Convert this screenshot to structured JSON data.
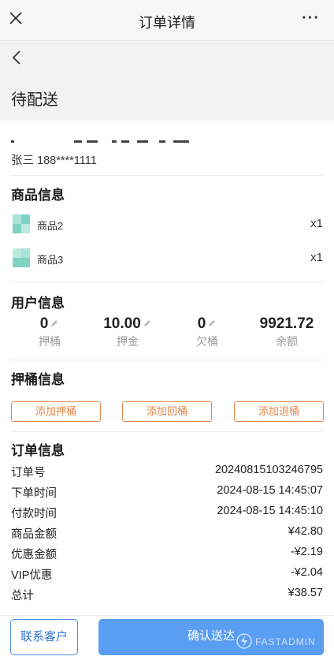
{
  "header": {
    "title": "订单详情",
    "more_label": "···"
  },
  "order_status": "待配送",
  "address": {
    "contact": "张三 188****1111"
  },
  "goods": {
    "title": "商品信息",
    "items": [
      {
        "name": "商品2",
        "qty": "x1"
      },
      {
        "name": "商品3",
        "qty": "x1"
      }
    ]
  },
  "user_info": {
    "title": "用户信息",
    "stats": [
      {
        "value": "0",
        "label": "押桶",
        "editable": true
      },
      {
        "value": "10.00",
        "label": "押金",
        "editable": true
      },
      {
        "value": "0",
        "label": "欠桶",
        "editable": true
      },
      {
        "value": "9921.72",
        "label": "余额",
        "editable": false
      }
    ]
  },
  "bucket_info": {
    "title": "押桶信息",
    "buttons": [
      "添加押桶",
      "添加回桶",
      "添加退桶"
    ]
  },
  "order_info": {
    "title": "订单信息",
    "rows": [
      {
        "key": "订单号",
        "value": "20240815103246795"
      },
      {
        "key": "下单时间",
        "value": "2024-08-15 14:45:07"
      },
      {
        "key": "付款时间",
        "value": "2024-08-15 14:45:10"
      },
      {
        "key": "商品金额",
        "value": "¥42.80"
      },
      {
        "key": "优惠金额",
        "value": "-¥2.19"
      },
      {
        "key": "VIP优惠",
        "value": "-¥2.04"
      },
      {
        "key": "总计",
        "value": "¥38.57"
      }
    ]
  },
  "actions": {
    "contact": "联系客户",
    "confirm": "确认送达"
  },
  "watermark": "FASTADMIN",
  "colors": {
    "accent_blue": "#5a9ef2",
    "accent_orange": "#e3874b",
    "thumb": "#7fd3c4"
  }
}
